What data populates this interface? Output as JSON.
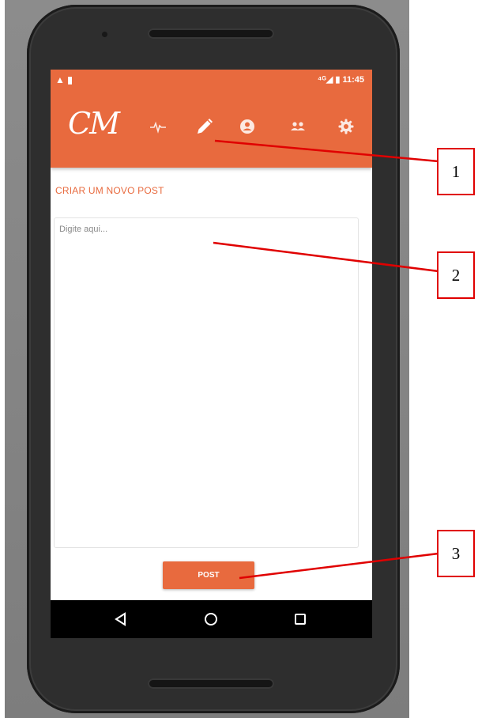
{
  "status_bar": {
    "left_icons": "▲ ▮",
    "right_text": "⁴ᴳ◢ ▮ 11:45"
  },
  "app_bar": {
    "logo": "CM",
    "icons": [
      "pulse-icon",
      "pencil-icon",
      "account-icon",
      "group-icon",
      "settings-icon"
    ],
    "accent_color": "#e86a3e"
  },
  "compose": {
    "title": "CRIAR UM NOVO POST",
    "placeholder": "Digite aqui...",
    "submit_label": "POST"
  },
  "nav_bar": {
    "icons": [
      "back-icon",
      "home-icon",
      "recents-icon"
    ]
  },
  "callouts": [
    {
      "label": "1"
    },
    {
      "label": "2"
    },
    {
      "label": "3"
    }
  ]
}
